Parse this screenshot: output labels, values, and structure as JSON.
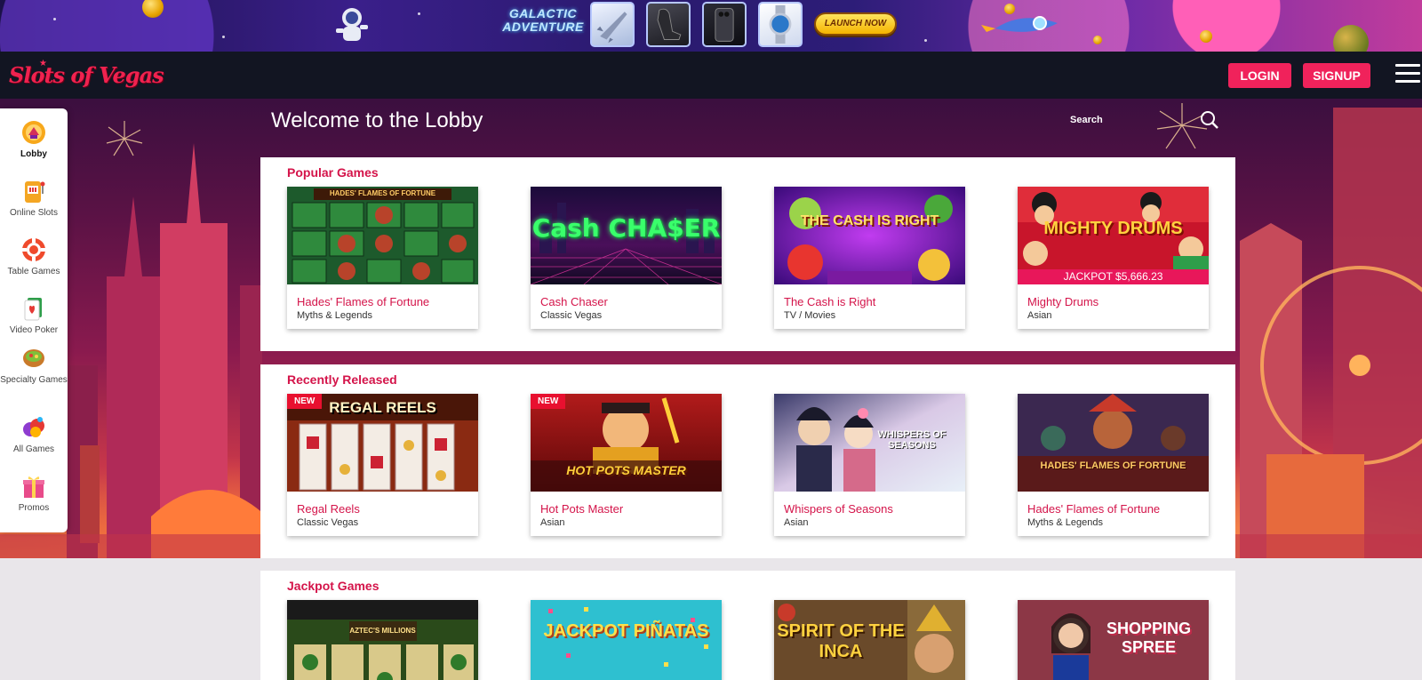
{
  "promo": {
    "title": "GALACTIC ADVENTURE",
    "cta_label": "LAUNCH NOW"
  },
  "header": {
    "logo_text": "Slots of Vegas",
    "login_label": "LOGIN",
    "signup_label": "SIGNUP"
  },
  "sidebar": {
    "items": [
      {
        "label": "Lobby",
        "icon": "lobby-icon"
      },
      {
        "label": "Online Slots",
        "icon": "slot-machine-icon"
      },
      {
        "label": "Table Games",
        "icon": "poker-chip-icon"
      },
      {
        "label": "Video Poker",
        "icon": "playing-card-icon"
      },
      {
        "label": "Specialty Games",
        "icon": "specialty-bowl-icon"
      },
      {
        "label": "All Games",
        "icon": "all-games-icon"
      },
      {
        "label": "Promos",
        "icon": "gift-icon"
      }
    ]
  },
  "lobby": {
    "title": "Welcome to the Lobby",
    "search_label": "Search",
    "search_value": ""
  },
  "sections": {
    "popular": {
      "title": "Popular Games",
      "games": [
        {
          "name": "Hades' Flames of Fortune",
          "category": "Myths & Legends",
          "thumb_text": "HADES' FLAMES OF FORTUNE"
        },
        {
          "name": "Cash Chaser",
          "category": "Classic Vegas",
          "thumb_text": "Cash CHA$ER"
        },
        {
          "name": "The Cash is Right",
          "category": "TV / Movies",
          "thumb_text": "THE CASH IS RIGHT"
        },
        {
          "name": "Mighty Drums",
          "category": "Asian",
          "thumb_text": "MIGHTY DRUMS",
          "jackpot": "JACKPOT $5,666.23"
        }
      ]
    },
    "recent": {
      "title": "Recently Released",
      "badge": "NEW",
      "games": [
        {
          "name": "Regal Reels",
          "category": "Classic Vegas",
          "thumb_text": "REGAL REELS",
          "is_new": true
        },
        {
          "name": "Hot Pots Master",
          "category": "Asian",
          "thumb_text": "HOT POTS MASTER",
          "is_new": true
        },
        {
          "name": "Whispers of Seasons",
          "category": "Asian",
          "thumb_text": "WHISPERS OF SEASONS"
        },
        {
          "name": "Hades' Flames of Fortune",
          "category": "Myths & Legends",
          "thumb_text": "HADES' FLAMES OF FORTUNE"
        }
      ]
    },
    "jackpot": {
      "title": "Jackpot Games",
      "games": [
        {
          "thumb_text": "AZTEC'S MILLIONS"
        },
        {
          "thumb_text": "JACKPOT PIÑATAS"
        },
        {
          "thumb_text": "SPIRIT OF THE INCA"
        },
        {
          "thumb_text": "SHOPPING SPREE"
        }
      ]
    }
  },
  "colors": {
    "accent": "#d4144a",
    "button": "#f0225b",
    "header_bg": "#121522"
  }
}
